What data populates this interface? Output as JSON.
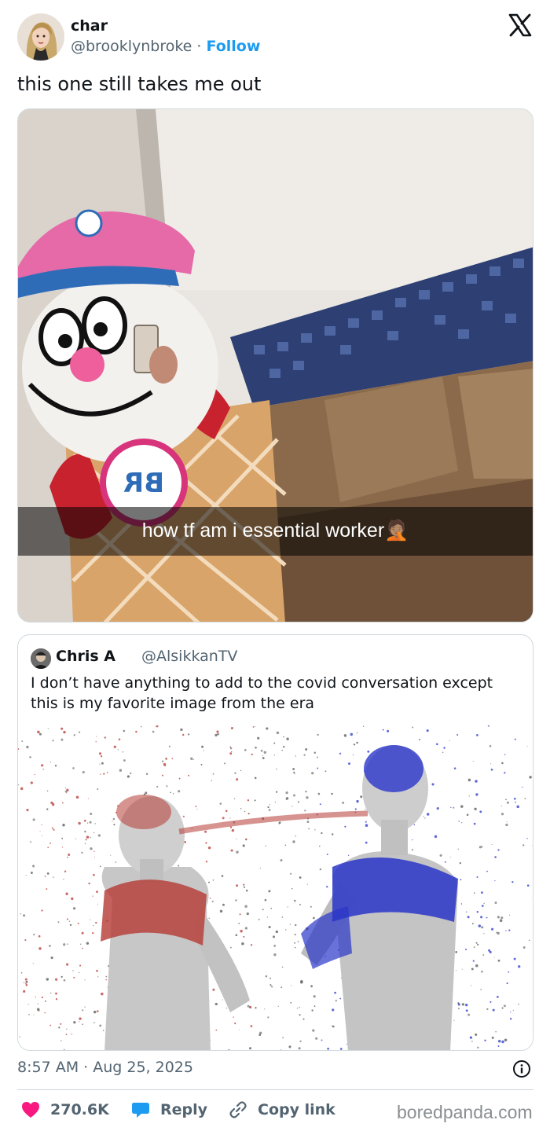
{
  "author": {
    "name": "char",
    "handle": "@brooklynbroke",
    "separator": " · ",
    "follow_label": "Follow"
  },
  "tweet_text": "this one still takes me out",
  "media_caption": "how tf am i essential worker",
  "media_caption_emoji": "🤦🏽",
  "costume_sign_text": "BR",
  "quoted": {
    "name": "Chris A",
    "handle": "@AlsikkanTV",
    "text": "I don’t have anything to add to the covid conversation except this is my favorite image from the era"
  },
  "timestamp": "8:57 AM · Aug 25, 2025",
  "actions": {
    "likes_count": "270.6K",
    "reply_label": "Reply",
    "copy_link_label": "Copy link"
  },
  "watermark": "boredpanda.com",
  "icons": [
    "x-logo-icon",
    "info-icon",
    "heart-icon",
    "reply-bubble-icon",
    "link-icon"
  ],
  "colors": {
    "follow": "#1d9bf0",
    "heart": "#f91880",
    "reply_bubble": "#1d9bf0",
    "secondary_text": "#536471"
  }
}
